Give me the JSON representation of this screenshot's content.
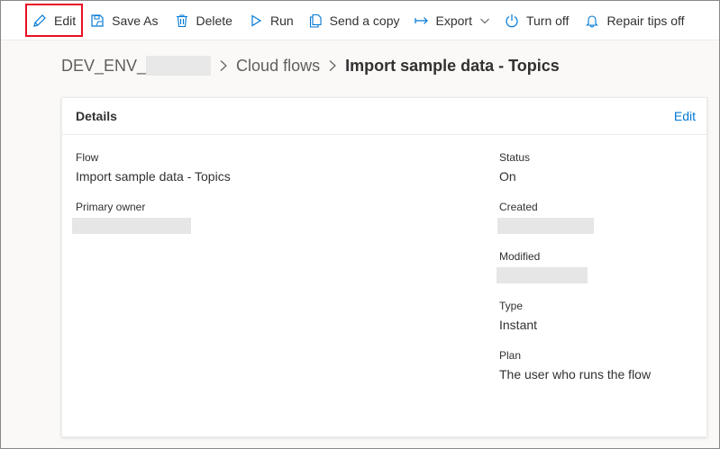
{
  "toolbar": {
    "edit_label": "Edit",
    "save_as_label": "Save As",
    "delete_label": "Delete",
    "run_label": "Run",
    "send_copy_label": "Send a copy",
    "export_label": "Export",
    "turn_off_label": "Turn off",
    "repair_tips_label": "Repair tips off"
  },
  "breadcrumb": {
    "environment": "DEV_ENV_",
    "section": "Cloud flows",
    "current": "Import sample data - Topics"
  },
  "details": {
    "title": "Details",
    "edit_link": "Edit",
    "flow_label": "Flow",
    "flow_value": "Import sample data - Topics",
    "owner_label": "Primary owner",
    "status_label": "Status",
    "status_value": "On",
    "created_label": "Created",
    "modified_label": "Modified",
    "type_label": "Type",
    "type_value": "Instant",
    "plan_label": "Plan",
    "plan_value": "The user who runs the flow"
  },
  "colors": {
    "accent": "#0078d4",
    "highlight_box": "#e81123",
    "icon": "#0078d4"
  },
  "icons": {
    "edit": "pencil-icon",
    "save_as": "save-as-icon",
    "delete": "trash-icon",
    "run": "play-icon",
    "send_copy": "copy-icon",
    "export": "export-arrow-icon",
    "turn_off": "power-icon",
    "repair_tips": "bell-icon"
  }
}
